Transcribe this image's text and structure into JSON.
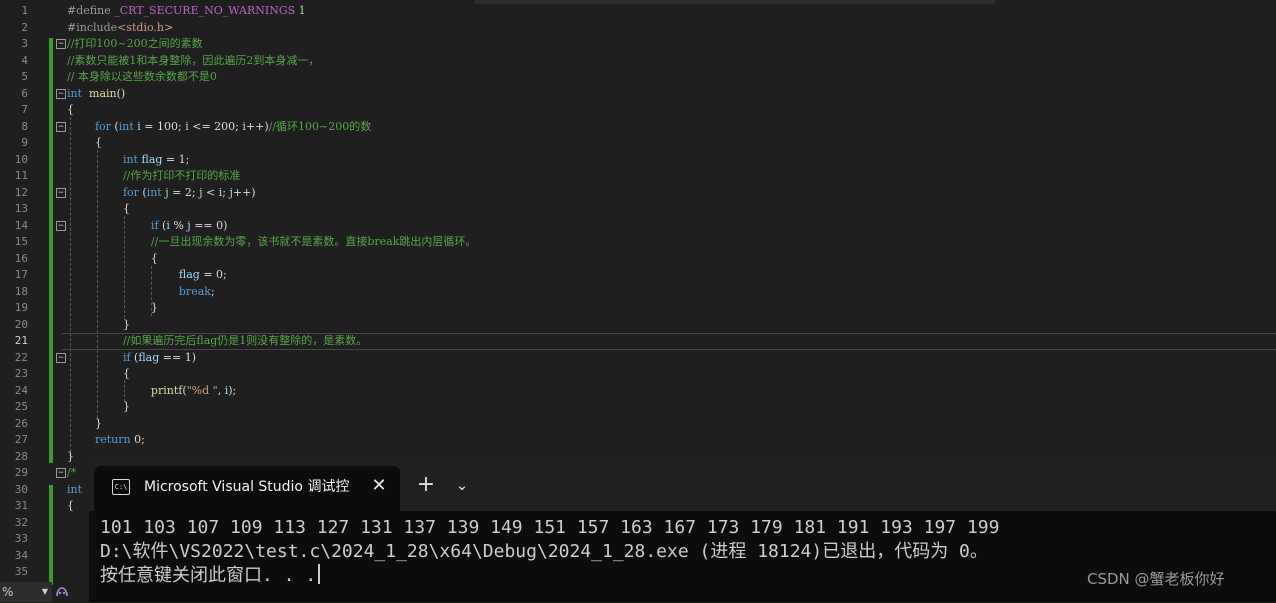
{
  "editor": {
    "current_line": 21,
    "lines": [
      {
        "n": "1",
        "t": [
          [
            "pp",
            "#define "
          ],
          [
            "mac",
            "_CRT_SECURE_NO_WARNINGS"
          ],
          [
            "nm",
            " 1"
          ]
        ]
      },
      {
        "n": "2",
        "t": [
          [
            "pp",
            "#include"
          ],
          [
            "str",
            "<stdio.h>"
          ]
        ]
      },
      {
        "n": "3",
        "t": [
          [
            "cm",
            "//打印100~200之间的素数"
          ]
        ]
      },
      {
        "n": "4",
        "t": [
          [
            "cm",
            "//素数只能被1和本身整除，因此遍历2到本身减一，"
          ]
        ]
      },
      {
        "n": "5",
        "t": [
          [
            "cm",
            "// 本身除以这些数余数都不是0"
          ]
        ]
      },
      {
        "n": "6",
        "t": [
          [
            "kw",
            "int"
          ],
          [
            "",
            "  "
          ],
          [
            "fn",
            "main"
          ],
          [
            "",
            "()"
          ]
        ]
      },
      {
        "n": "7",
        "t": [
          [
            "",
            "{"
          ]
        ]
      },
      {
        "n": "8",
        "t": [
          [
            "",
            "        "
          ],
          [
            "kw",
            "for"
          ],
          [
            "",
            " ("
          ],
          [
            "kw",
            "int"
          ],
          [
            "",
            " "
          ],
          [
            "id",
            "i"
          ],
          [
            "",
            " = 100; "
          ],
          [
            "id",
            "i"
          ],
          [
            "",
            " <= 200; "
          ],
          [
            "id",
            "i"
          ],
          [
            "",
            "++)"
          ],
          [
            "cm",
            "//循环100~200的数"
          ]
        ]
      },
      {
        "n": "9",
        "t": [
          [
            "",
            "        {"
          ]
        ]
      },
      {
        "n": "10",
        "t": [
          [
            "",
            "                "
          ],
          [
            "kw",
            "int"
          ],
          [
            "",
            " "
          ],
          [
            "id",
            "flag"
          ],
          [
            "",
            " = 1;"
          ]
        ]
      },
      {
        "n": "11",
        "t": [
          [
            "",
            "                "
          ],
          [
            "cm",
            "//作为打印不打印的标准"
          ]
        ]
      },
      {
        "n": "12",
        "t": [
          [
            "",
            "                "
          ],
          [
            "kw",
            "for"
          ],
          [
            "",
            " ("
          ],
          [
            "kw",
            "int"
          ],
          [
            "",
            " "
          ],
          [
            "id",
            "j"
          ],
          [
            "",
            " = 2; "
          ],
          [
            "id",
            "j"
          ],
          [
            "",
            " < "
          ],
          [
            "id",
            "i"
          ],
          [
            "",
            "; "
          ],
          [
            "id",
            "j"
          ],
          [
            "",
            "++)"
          ]
        ]
      },
      {
        "n": "13",
        "t": [
          [
            "",
            "                {"
          ]
        ]
      },
      {
        "n": "14",
        "t": [
          [
            "",
            "                        "
          ],
          [
            "kw",
            "if"
          ],
          [
            "",
            " ("
          ],
          [
            "id",
            "i"
          ],
          [
            "",
            " % "
          ],
          [
            "id",
            "j"
          ],
          [
            "",
            " == 0)"
          ]
        ]
      },
      {
        "n": "15",
        "t": [
          [
            "",
            "                        "
          ],
          [
            "cm",
            "//一旦出现余数为零，该书就不是素数。直接break跳出内层循环。"
          ]
        ]
      },
      {
        "n": "16",
        "t": [
          [
            "",
            "                        {"
          ]
        ]
      },
      {
        "n": "17",
        "t": [
          [
            "",
            "                                "
          ],
          [
            "id",
            "flag"
          ],
          [
            "",
            " = 0;"
          ]
        ]
      },
      {
        "n": "18",
        "t": [
          [
            "",
            "                                "
          ],
          [
            "kw",
            "break"
          ],
          [
            "",
            ";"
          ]
        ]
      },
      {
        "n": "19",
        "t": [
          [
            "",
            "                        }"
          ]
        ]
      },
      {
        "n": "20",
        "t": [
          [
            "",
            "                }"
          ]
        ]
      },
      {
        "n": "21",
        "t": [
          [
            "",
            "                "
          ],
          [
            "cm",
            "//如果遍历完后flag仍是1则没有整除的，是素数。"
          ]
        ]
      },
      {
        "n": "22",
        "t": [
          [
            "",
            "                "
          ],
          [
            "kw",
            "if"
          ],
          [
            "",
            " ("
          ],
          [
            "id",
            "flag"
          ],
          [
            "",
            " == 1)"
          ]
        ]
      },
      {
        "n": "23",
        "t": [
          [
            "",
            "                {"
          ]
        ]
      },
      {
        "n": "24",
        "t": [
          [
            "",
            "                        "
          ],
          [
            "fn",
            "printf"
          ],
          [
            "",
            "("
          ],
          [
            "str",
            "\"%d \""
          ],
          [
            "",
            ", "
          ],
          [
            "id",
            "i"
          ],
          [
            "",
            ");"
          ]
        ]
      },
      {
        "n": "25",
        "t": [
          [
            "",
            "                }"
          ]
        ]
      },
      {
        "n": "26",
        "t": [
          [
            "",
            "        }"
          ]
        ]
      },
      {
        "n": "27",
        "t": [
          [
            "",
            "        "
          ],
          [
            "kw",
            "return"
          ],
          [
            "",
            " 0;"
          ]
        ]
      },
      {
        "n": "28",
        "t": [
          [
            "",
            "}"
          ]
        ]
      },
      {
        "n": "29",
        "t": [
          [
            "cm",
            "/*"
          ]
        ]
      },
      {
        "n": "30",
        "t": [
          [
            "kw",
            "int"
          ]
        ]
      },
      {
        "n": "31",
        "t": [
          [
            "",
            "{"
          ]
        ]
      },
      {
        "n": "32",
        "t": [
          [
            "",
            ""
          ]
        ]
      },
      {
        "n": "33",
        "t": [
          [
            "",
            ""
          ]
        ]
      },
      {
        "n": "34",
        "t": [
          [
            "",
            ""
          ]
        ]
      },
      {
        "n": "35",
        "t": [
          [
            "",
            ""
          ]
        ]
      }
    ],
    "fold_lines": [
      "3",
      "6",
      "8",
      "12",
      "14",
      "22",
      "29"
    ],
    "zoom_label": "%",
    "zoom_dropdown_icon": "chevron-down-icon",
    "extension_icon": "copilot-icon"
  },
  "terminal": {
    "tab_title": "Microsoft Visual Studio 调试控制台",
    "tab_icon": "console-icon",
    "close_icon": "close-icon",
    "new_tab_label": "+",
    "dropdown_icon": "chevron-down-icon",
    "output_lines": [
      "101 103 107 109 113 127 131 137 139 149 151 157 163 167 173 179 181 191 193 197 199",
      "D:\\软件\\VS2022\\test.c\\2024_1_28\\x64\\Debug\\2024_1_28.exe (进程 18124)已退出，代码为 0。",
      "按任意键关闭此窗口. . ."
    ],
    "watermark": "CSDN @蟹老板你好"
  },
  "colors": {
    "editor_bg": "#1f1f1f",
    "terminal_bg": "#0c0c0c",
    "keyword": "#569cd6",
    "comment": "#57a64a",
    "string": "#d69d85",
    "change_bar": "#3e9c2f"
  }
}
